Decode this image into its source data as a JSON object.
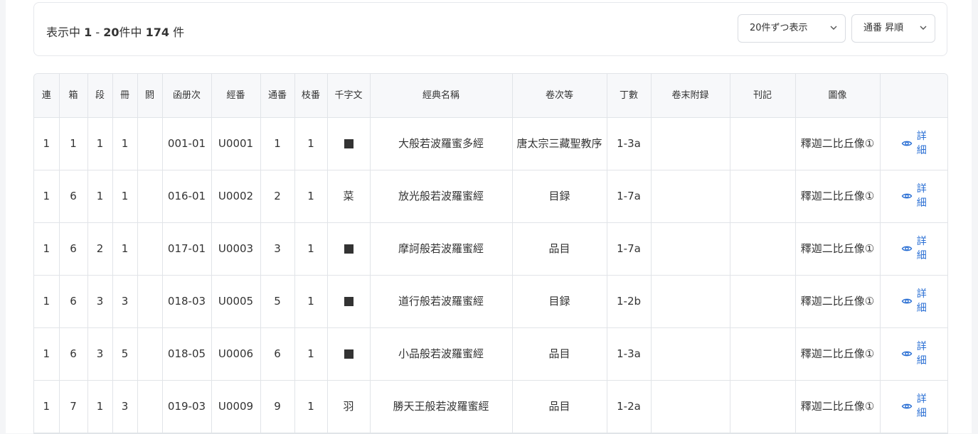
{
  "pager": {
    "prefix": "表示中",
    "from": "1",
    "sep": "-",
    "to": "20",
    "mid": "件中",
    "total": "174",
    "suffix": "件"
  },
  "controls": {
    "per_page": "20件ずつ表示",
    "sort": "通番 昇順"
  },
  "table": {
    "headers": [
      "連",
      "箱",
      "段",
      "冊",
      "閼",
      "函册次",
      "經番",
      "通番",
      "枝番",
      "千字文",
      "經典名稱",
      "卷次等",
      "丁數",
      "卷末附録",
      "刊記",
      "圖像",
      ""
    ],
    "detail_label": "詳細",
    "rows": [
      {
        "ren": "1",
        "hako": "1",
        "dan": "1",
        "satsu": "1",
        "etsu": "",
        "kansatsu": "001-01",
        "kyoban": "U0001",
        "tsuban": "1",
        "edaban": "1",
        "senjimon": "",
        "senjimon_mark": true,
        "title": "大般若波羅蜜多經",
        "kanji": "唐太宗三藏聖教序",
        "chosu": "1-3a",
        "kanmatsu": "",
        "kanki": "",
        "zuzo": "釋迦二比丘像①"
      },
      {
        "ren": "1",
        "hako": "6",
        "dan": "1",
        "satsu": "1",
        "etsu": "",
        "kansatsu": "016-01",
        "kyoban": "U0002",
        "tsuban": "2",
        "edaban": "1",
        "senjimon": "菜",
        "senjimon_mark": false,
        "title": "放光般若波羅蜜經",
        "kanji": "目録",
        "chosu": "1-7a",
        "kanmatsu": "",
        "kanki": "",
        "zuzo": "釋迦二比丘像①"
      },
      {
        "ren": "1",
        "hako": "6",
        "dan": "2",
        "satsu": "1",
        "etsu": "",
        "kansatsu": "017-01",
        "kyoban": "U0003",
        "tsuban": "3",
        "edaban": "1",
        "senjimon": "",
        "senjimon_mark": true,
        "title": "摩訶般若波羅蜜經",
        "kanji": "品目",
        "chosu": "1-7a",
        "kanmatsu": "",
        "kanki": "",
        "zuzo": "釋迦二比丘像①"
      },
      {
        "ren": "1",
        "hako": "6",
        "dan": "3",
        "satsu": "3",
        "etsu": "",
        "kansatsu": "018-03",
        "kyoban": "U0005",
        "tsuban": "5",
        "edaban": "1",
        "senjimon": "",
        "senjimon_mark": true,
        "title": "道行般若波羅蜜經",
        "kanji": "目録",
        "chosu": "1-2b",
        "kanmatsu": "",
        "kanki": "",
        "zuzo": "釋迦二比丘像①"
      },
      {
        "ren": "1",
        "hako": "6",
        "dan": "3",
        "satsu": "5",
        "etsu": "",
        "kansatsu": "018-05",
        "kyoban": "U0006",
        "tsuban": "6",
        "edaban": "1",
        "senjimon": "",
        "senjimon_mark": true,
        "title": "小品般若波羅蜜經",
        "kanji": "品目",
        "chosu": "1-3a",
        "kanmatsu": "",
        "kanki": "",
        "zuzo": "釋迦二比丘像①"
      },
      {
        "ren": "1",
        "hako": "7",
        "dan": "1",
        "satsu": "3",
        "etsu": "",
        "kansatsu": "019-03",
        "kyoban": "U0009",
        "tsuban": "9",
        "edaban": "1",
        "senjimon": "羽",
        "senjimon_mark": false,
        "title": "勝天王般若波羅蜜經",
        "kanji": "品目",
        "chosu": "1-2a",
        "kanmatsu": "",
        "kanki": "",
        "zuzo": "釋迦二比丘像①"
      }
    ]
  },
  "colors": {
    "link": "#2a6fd4",
    "border": "#e1e4e8",
    "header_bg": "#f7f8fa"
  }
}
